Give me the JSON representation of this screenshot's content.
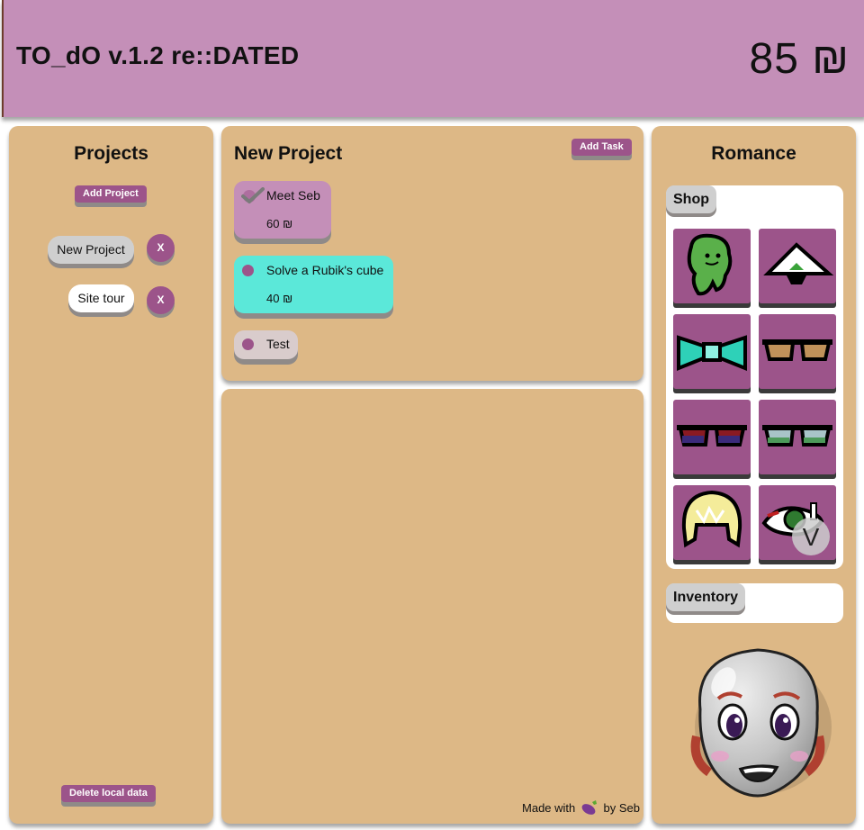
{
  "header": {
    "title": "TO_dO v.1.2 re::DATED",
    "money": "85 ₪"
  },
  "projects": {
    "title": "Projects",
    "add_label": "Add Project",
    "items": [
      {
        "label": "New Project",
        "remove_label": "X"
      },
      {
        "label": "Site tour",
        "remove_label": "X"
      }
    ],
    "delete_label": "Delete local data"
  },
  "tasks": {
    "title": "New Project",
    "add_label": "Add Task",
    "items": [
      {
        "name": "Meet Seb",
        "price": "60 ₪",
        "state": "done"
      },
      {
        "name": "Solve a Rubik's cube",
        "price": "40 ₪",
        "state": "selected"
      },
      {
        "name": "Test",
        "price": "",
        "state": "open"
      }
    ]
  },
  "footer": {
    "before": "Made with",
    "after": "by Seb"
  },
  "romance": {
    "title": "Romance",
    "shop_label": "Shop",
    "inventory_label": "Inventory",
    "scroll_label": "V",
    "shop_items": [
      {
        "icon": "green-blob-icon"
      },
      {
        "icon": "white-hat-icon"
      },
      {
        "icon": "teal-bowtie-icon"
      },
      {
        "icon": "brown-sunglasses-icon"
      },
      {
        "icon": "red-sunglasses-icon"
      },
      {
        "icon": "blue-sunglasses-icon"
      },
      {
        "icon": "blonde-hair-icon"
      },
      {
        "icon": "eye-patch-icon"
      }
    ]
  },
  "colors": {
    "header": "#c48fb8",
    "panel": "#ddb886",
    "accent": "#9c548a",
    "task_done": "#c48fb8",
    "task_selected": "#5be8d9",
    "task_open": "#d9cccc"
  }
}
